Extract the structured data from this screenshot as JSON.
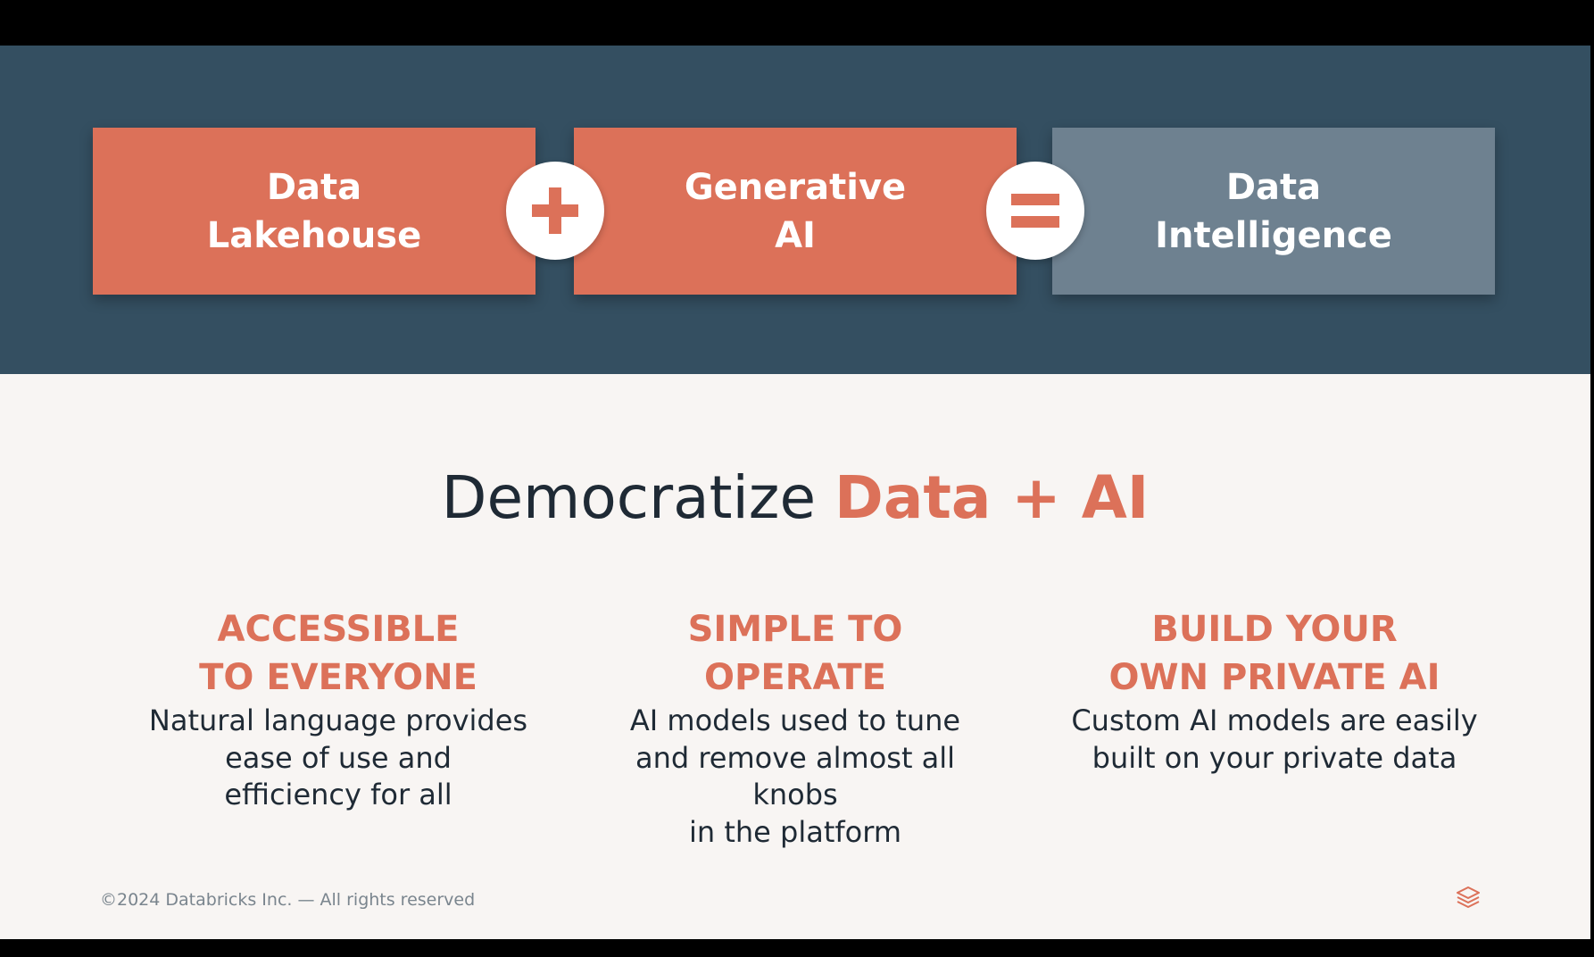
{
  "equation": {
    "box1": "Data\nLakehouse",
    "box2": "Generative\nAI",
    "box3": "Data\nIntelligence",
    "plus_icon": "plus-icon",
    "equals_icon": "equals-icon"
  },
  "headline": {
    "prefix": "Democratize ",
    "accent": "Data + AI"
  },
  "columns": [
    {
      "title": "ACCESSIBLE\nTO EVERYONE",
      "description": "Natural language provides\nease of use and\nefficiency for all"
    },
    {
      "title": "SIMPLE TO\nOPERATE",
      "description": "AI models used to tune\nand remove almost all\nknobs\nin the platform"
    },
    {
      "title": "BUILD YOUR\nOWN PRIVATE AI",
      "description": "Custom AI models are easily\nbuilt on your private data"
    }
  ],
  "footer": {
    "copyright": "©2024 Databricks Inc. — All rights reserved",
    "logo_icon": "databricks-logo-icon"
  },
  "colors": {
    "band": "#344f61",
    "accent": "#dc7159",
    "intelligence": "#6e8190",
    "background": "#f8f5f3",
    "text": "#1f2a35"
  }
}
